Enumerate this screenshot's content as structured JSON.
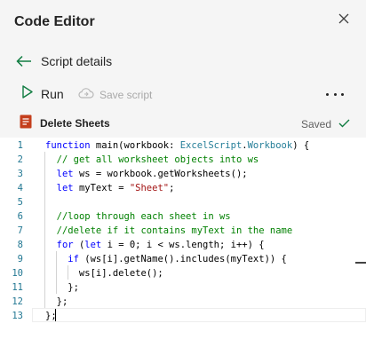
{
  "header": {
    "title": "Code Editor",
    "close_icon": "close-icon"
  },
  "nav": {
    "back_label": "Script details"
  },
  "toolbar": {
    "run_label": "Run",
    "save_label": "Save script",
    "more_icon": "more-icon"
  },
  "file": {
    "name": "Delete Sheets",
    "status": "Saved"
  },
  "colors": {
    "accent_green": "#107c41",
    "keyword": "#0000ff",
    "comment": "#008000",
    "string": "#a31515",
    "type": "#267f99",
    "line_number": "#237893"
  },
  "editor": {
    "line_numbers": [
      "1",
      "2",
      "3",
      "4",
      "5",
      "6",
      "7",
      "8",
      "9",
      "10",
      "11",
      "12",
      "13"
    ],
    "lines": [
      [
        [
          "kw",
          "function"
        ],
        [
          "pl",
          " main(workbook: "
        ],
        [
          "ty",
          "ExcelScript"
        ],
        [
          "pl",
          "."
        ],
        [
          "ty",
          "Workbook"
        ],
        [
          "pl",
          ") {"
        ]
      ],
      [
        [
          "pl",
          "  "
        ],
        [
          "cm",
          "// get all worksheet objects into ws"
        ]
      ],
      [
        [
          "pl",
          "  "
        ],
        [
          "kw",
          "let"
        ],
        [
          "pl",
          " ws = workbook.getWorksheets();"
        ]
      ],
      [
        [
          "pl",
          "  "
        ],
        [
          "kw",
          "let"
        ],
        [
          "pl",
          " myText = "
        ],
        [
          "st",
          "\"Sheet\""
        ],
        [
          "pl",
          ";"
        ]
      ],
      [
        [
          "pl",
          ""
        ]
      ],
      [
        [
          "pl",
          "  "
        ],
        [
          "cm",
          "//loop through each sheet in ws"
        ]
      ],
      [
        [
          "pl",
          "  "
        ],
        [
          "cm",
          "//delete if it contains myText in the name"
        ]
      ],
      [
        [
          "pl",
          "  "
        ],
        [
          "kw",
          "for"
        ],
        [
          "pl",
          " ("
        ],
        [
          "kw",
          "let"
        ],
        [
          "pl",
          " i = 0; i < ws.length; i++) {"
        ]
      ],
      [
        [
          "pl",
          "    "
        ],
        [
          "kw",
          "if"
        ],
        [
          "pl",
          " (ws[i].getName().includes(myText)) {"
        ]
      ],
      [
        [
          "pl",
          "      ws[i].delete();"
        ]
      ],
      [
        [
          "pl",
          "    };"
        ]
      ],
      [
        [
          "pl",
          "  };"
        ]
      ],
      [
        [
          "pl",
          "};"
        ]
      ]
    ]
  }
}
